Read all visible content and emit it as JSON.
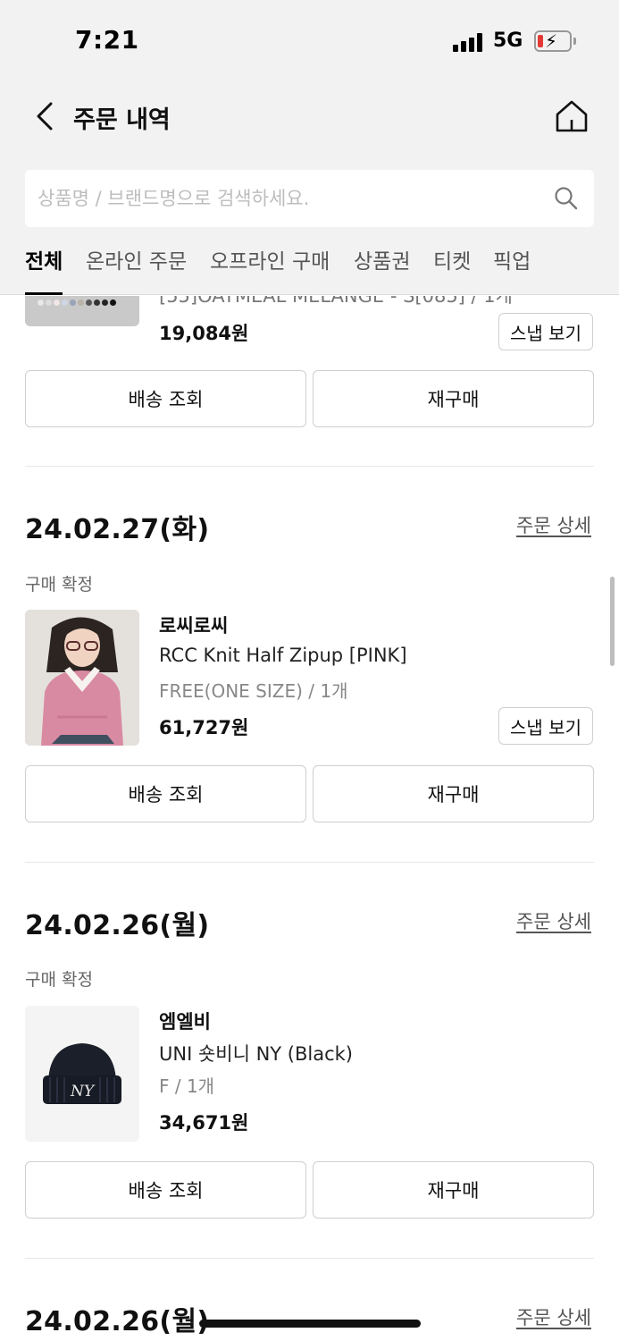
{
  "status_bar": {
    "time": "7:21",
    "network": "5G",
    "battery_color": "#e53935"
  },
  "header": {
    "title": "주문 내역"
  },
  "search": {
    "placeholder": "상품명 / 브랜드명으로 검색하세요."
  },
  "tabs": [
    {
      "label": "전체",
      "active": true
    },
    {
      "label": "온라인 주문",
      "active": false
    },
    {
      "label": "오프라인 구매",
      "active": false
    },
    {
      "label": "상품권",
      "active": false
    },
    {
      "label": "티켓",
      "active": false
    },
    {
      "label": "픽업",
      "active": false
    }
  ],
  "orders": [
    {
      "cut_text": "[55]OATMEAL MELANGE - S[085] / 1개",
      "price": "19,084원",
      "snap_label": "스냅 보기",
      "buttons": {
        "delivery": "배송 조회",
        "reorder": "재구매"
      }
    },
    {
      "date": "24.02.27(화)",
      "detail_link": "주문 상세",
      "status": "구매 확정",
      "brand": "로씨로씨",
      "name": "RCC Knit Half Zipup [PINK]",
      "option": "FREE(ONE SIZE) / 1개",
      "price": "61,727원",
      "snap_label": "스냅 보기",
      "buttons": {
        "delivery": "배송 조회",
        "reorder": "재구매"
      }
    },
    {
      "date": "24.02.26(월)",
      "detail_link": "주문 상세",
      "status": "구매 확정",
      "brand": "엠엘비",
      "name": "UNI 숏비니 NY (Black)",
      "option": "F / 1개",
      "price": "34,671원",
      "logo": "NY",
      "buttons": {
        "delivery": "배송 조회",
        "reorder": "재구매"
      }
    },
    {
      "date": "24.02.26(월)",
      "detail_link": "주문 상세"
    }
  ]
}
